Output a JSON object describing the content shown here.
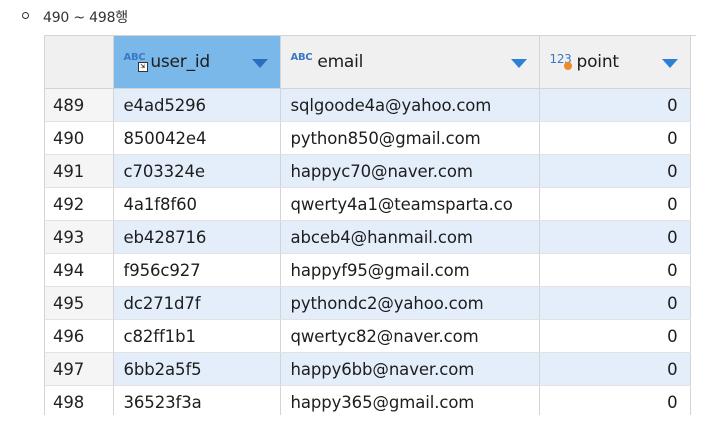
{
  "caption": {
    "text": "490 ~ 498행"
  },
  "table": {
    "columns": [
      {
        "name": "user_id",
        "type_icon": "ABC",
        "type_name": "text-type-icon",
        "selected": true
      },
      {
        "name": "email",
        "type_icon": "ABC",
        "type_name": "text-type-icon",
        "selected": false
      },
      {
        "name": "point",
        "type_icon": "123",
        "type_name": "numeric-type-icon",
        "selected": false
      }
    ],
    "rows": [
      {
        "row": "489",
        "user_id": "e4ad5296",
        "email": "sqlgoode4a@yahoo.com",
        "point": "0"
      },
      {
        "row": "490",
        "user_id": "850042e4",
        "email": "python850@gmail.com",
        "point": "0"
      },
      {
        "row": "491",
        "user_id": "c703324e",
        "email": "happyc70@naver.com",
        "point": "0"
      },
      {
        "row": "492",
        "user_id": "4a1f8f60",
        "email": "qwerty4a1@teamsparta.co",
        "point": "0"
      },
      {
        "row": "493",
        "user_id": "eb428716",
        "email": "abceb4@hanmail.com",
        "point": "0"
      },
      {
        "row": "494",
        "user_id": "f956c927",
        "email": "happyf95@gmail.com",
        "point": "0"
      },
      {
        "row": "495",
        "user_id": "dc271d7f",
        "email": "pythondc2@yahoo.com",
        "point": "0"
      },
      {
        "row": "496",
        "user_id": "c82ff1b1",
        "email": "qwertyc82@naver.com",
        "point": "0"
      },
      {
        "row": "497",
        "user_id": "6bb2a5f5",
        "email": "happy6bb@naver.com",
        "point": "0"
      },
      {
        "row": "498",
        "user_id": "36523f3a",
        "email": "happy365@gmail.com",
        "point": "0"
      }
    ]
  },
  "colors": {
    "selected_header": "#7ab8ea",
    "striped_row": "#e4eefb",
    "sort_arrow": "#2e7fd6",
    "type_icon": "#3a79c4",
    "numeric_badge": "#f08a24"
  }
}
